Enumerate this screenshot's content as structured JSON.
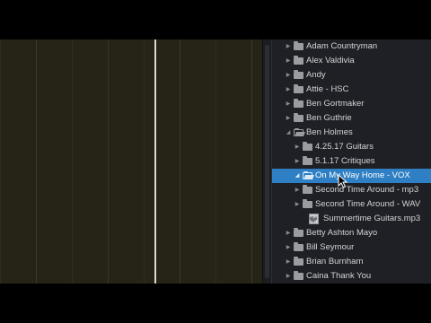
{
  "browser": {
    "items": [
      {
        "label": "Adam Countryman",
        "icon": "folder-icon",
        "expanded": false,
        "level": 0
      },
      {
        "label": "Alex Valdivia",
        "icon": "folder-icon",
        "expanded": false,
        "level": 0
      },
      {
        "label": "Andy",
        "icon": "folder-icon",
        "expanded": false,
        "level": 0
      },
      {
        "label": "Attie - HSC",
        "icon": "folder-icon",
        "expanded": false,
        "level": 0
      },
      {
        "label": "Ben Gortmaker",
        "icon": "folder-icon",
        "expanded": false,
        "level": 0
      },
      {
        "label": "Ben Guthrie",
        "icon": "folder-icon",
        "expanded": false,
        "level": 0
      },
      {
        "label": "Ben Holmes",
        "icon": "folder-open-icon",
        "expanded": true,
        "level": 0
      },
      {
        "label": "4.25.17 Guitars",
        "icon": "folder-icon",
        "expanded": false,
        "level": 1
      },
      {
        "label": "5.1.17 Critiques",
        "icon": "folder-icon",
        "expanded": false,
        "level": 1
      },
      {
        "label": "On My Way Home - VOX",
        "icon": "folder-open-icon",
        "expanded": true,
        "level": 1,
        "selected": true
      },
      {
        "label": "Second Time Around - mp3",
        "icon": "folder-icon",
        "expanded": false,
        "level": 1
      },
      {
        "label": "Second Time Around - WAV",
        "icon": "folder-icon",
        "expanded": false,
        "level": 1
      },
      {
        "label": "Summertime Guitars.mp3",
        "icon": "audio-file-icon",
        "expanded": false,
        "level": 1,
        "file": true
      },
      {
        "label": "Betty Ashton Mayo",
        "icon": "folder-icon",
        "expanded": false,
        "level": 0
      },
      {
        "label": "Bill Seymour",
        "icon": "folder-icon",
        "expanded": false,
        "level": 0
      },
      {
        "label": "Brian Burnham",
        "icon": "folder-icon",
        "expanded": false,
        "level": 0
      },
      {
        "label": "Caina Thank You",
        "icon": "folder-icon",
        "expanded": false,
        "level": 0
      }
    ]
  },
  "colors": {
    "selection": "#2f7fc4",
    "browser_bg": "#1f2025",
    "editor_bg": "#262416",
    "text": "#d3d4d6"
  }
}
